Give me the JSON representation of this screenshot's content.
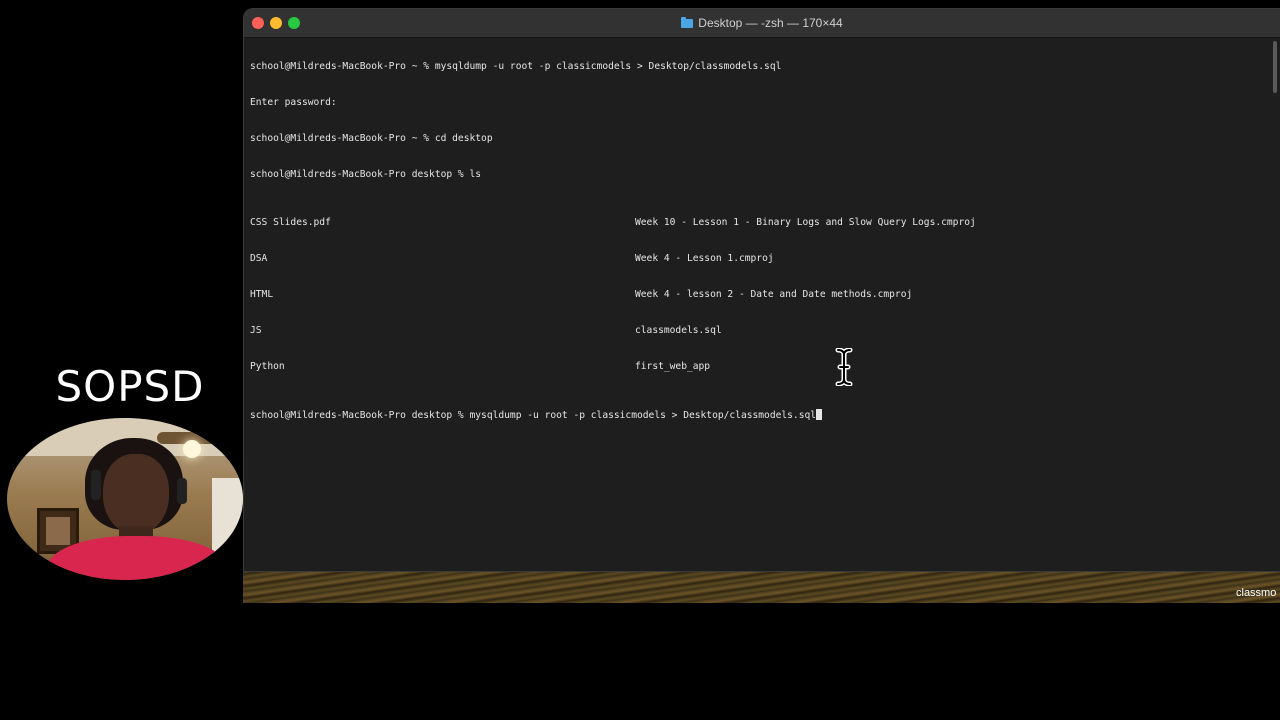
{
  "presenter": {
    "brand": "SOPSD"
  },
  "desktop": {
    "partial_label": "classmo"
  },
  "terminal": {
    "title": "Desktop — -zsh — 170×44",
    "lines": [
      "school@Mildreds-MacBook-Pro ~ % mysqldump -u root -p classicmodels > Desktop/classmodels.sql",
      "Enter password:",
      "school@Mildreds-MacBook-Pro ~ % cd desktop",
      "school@Mildreds-MacBook-Pro desktop % ls"
    ],
    "ls_left": [
      "CSS Slides.pdf",
      "DSA",
      "HTML",
      "JS",
      "Python"
    ],
    "ls_right": [
      "Week 10 - Lesson 1 - Binary Logs and Slow Query Logs.cmproj",
      "Week 4 - Lesson 1.cmproj",
      "Week 4 - lesson 2 - Date and Date methods.cmproj",
      "classmodels.sql",
      "first_web_app"
    ],
    "current_prompt": "school@Mildreds-MacBook-Pro desktop % mysqldump -u root -p classicmodels > Desktop/classmodels.sql"
  },
  "colors": {
    "terminal_bg": "#1e1e1e",
    "titlebar_bg": "#323232",
    "text": "#e6e6e6",
    "close": "#fe5f57",
    "minimize": "#febc2e",
    "maximize": "#28c840",
    "folder": "#4aa6e6"
  }
}
